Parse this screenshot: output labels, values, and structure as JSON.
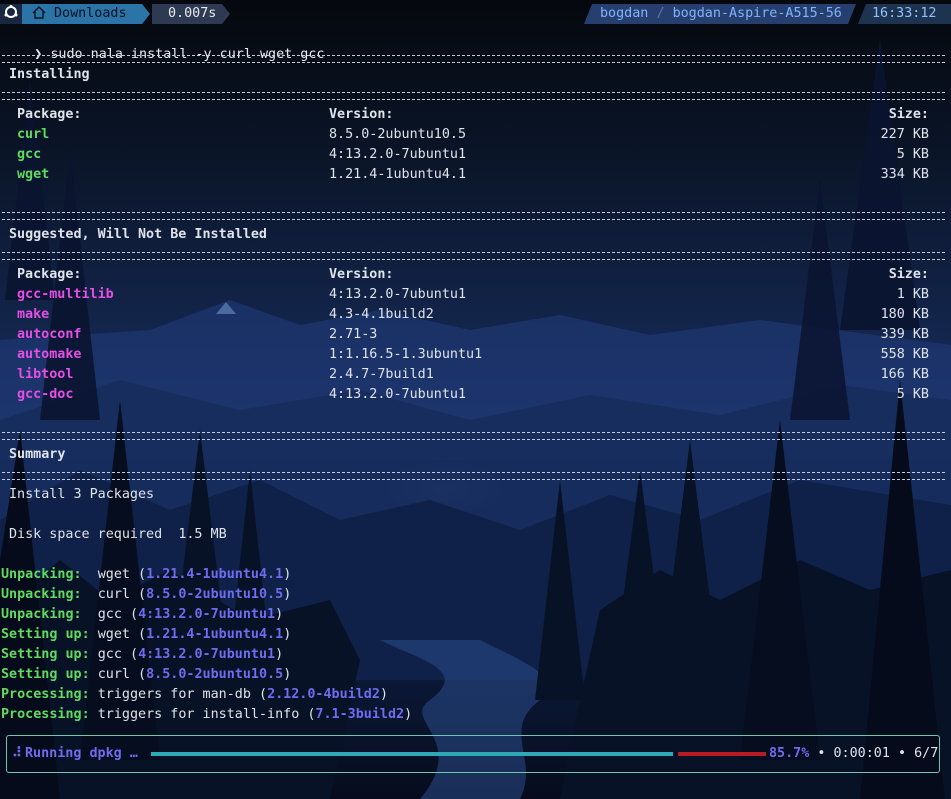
{
  "prompt": {
    "directory": "Downloads",
    "duration": "0.007s",
    "user": "bogdan",
    "separator": "/",
    "host": "bogdan-Aspire-A515-56",
    "clock": "16:33:12",
    "symbol": "❯",
    "command": "sudo nala install -y curl wget gcc"
  },
  "installing": {
    "title": "Installing",
    "headers": {
      "package": "Package:",
      "version": "Version:",
      "size": "Size:"
    },
    "rows": [
      {
        "package": "curl",
        "version": "8.5.0-2ubuntu10.5",
        "size": "227 KB"
      },
      {
        "package": "gcc",
        "version": "4:13.2.0-7ubuntu1",
        "size": "5 KB"
      },
      {
        "package": "wget",
        "version": "1.21.4-1ubuntu4.1",
        "size": "334 KB"
      }
    ]
  },
  "suggested": {
    "title": "Suggested, Will Not Be Installed",
    "headers": {
      "package": "Package:",
      "version": "Version:",
      "size": "Size:"
    },
    "rows": [
      {
        "package": "gcc-multilib",
        "version": "4:13.2.0-7ubuntu1",
        "size": "1 KB"
      },
      {
        "package": "make",
        "version": "4.3-4.1build2",
        "size": "180 KB"
      },
      {
        "package": "autoconf",
        "version": "2.71-3",
        "size": "339 KB"
      },
      {
        "package": "automake",
        "version": "1:1.16.5-1.3ubuntu1",
        "size": "558 KB"
      },
      {
        "package": "libtool",
        "version": "2.4.7-7build1",
        "size": "166 KB"
      },
      {
        "package": "gcc-doc",
        "version": "4:13.2.0-7ubuntu1",
        "size": "5 KB"
      }
    ]
  },
  "summary": {
    "title": "Summary",
    "install_line": "Install 3 Packages",
    "disk_label": "Disk space required",
    "disk_value": "1.5 MB"
  },
  "log": [
    {
      "action": "Unpacking:",
      "text": "wget (",
      "version": "1.21.4-1ubuntu4.1",
      "tail": ")"
    },
    {
      "action": "Unpacking:",
      "text": "curl (",
      "version": "8.5.0-2ubuntu10.5",
      "tail": ")"
    },
    {
      "action": "Unpacking:",
      "text": "gcc (",
      "version": "4:13.2.0-7ubuntu1",
      "tail": ")"
    },
    {
      "action": "Setting up:",
      "text": "wget (",
      "version": "1.21.4-1ubuntu4.1",
      "tail": ")"
    },
    {
      "action": "Setting up:",
      "text": "gcc (",
      "version": "4:13.2.0-7ubuntu1",
      "tail": ")"
    },
    {
      "action": "Setting up:",
      "text": "curl (",
      "version": "8.5.0-2ubuntu10.5",
      "tail": ")"
    },
    {
      "action": "Processing:",
      "text": "triggers for man-db (",
      "version": "2.12.0-4build2",
      "tail": ")"
    },
    {
      "action": "Processing:",
      "text": "triggers for install-info (",
      "version": "7.1-3build2",
      "tail": ")"
    }
  ],
  "progress": {
    "spinner": "⠼",
    "label": "Running dpkg …",
    "fraction": 0.857,
    "percent": "85.7%",
    "bullet": "•",
    "elapsed": "0:00:01",
    "steps": "6/7"
  },
  "colors": {
    "package_installed": "#5fdc5f",
    "package_suggested": "#e64fe6",
    "version_highlight": "#6f6cf0",
    "progress_done": "#2fa8b8",
    "progress_remaining": "#b81b24",
    "panel_border": "#6fc7b0"
  }
}
